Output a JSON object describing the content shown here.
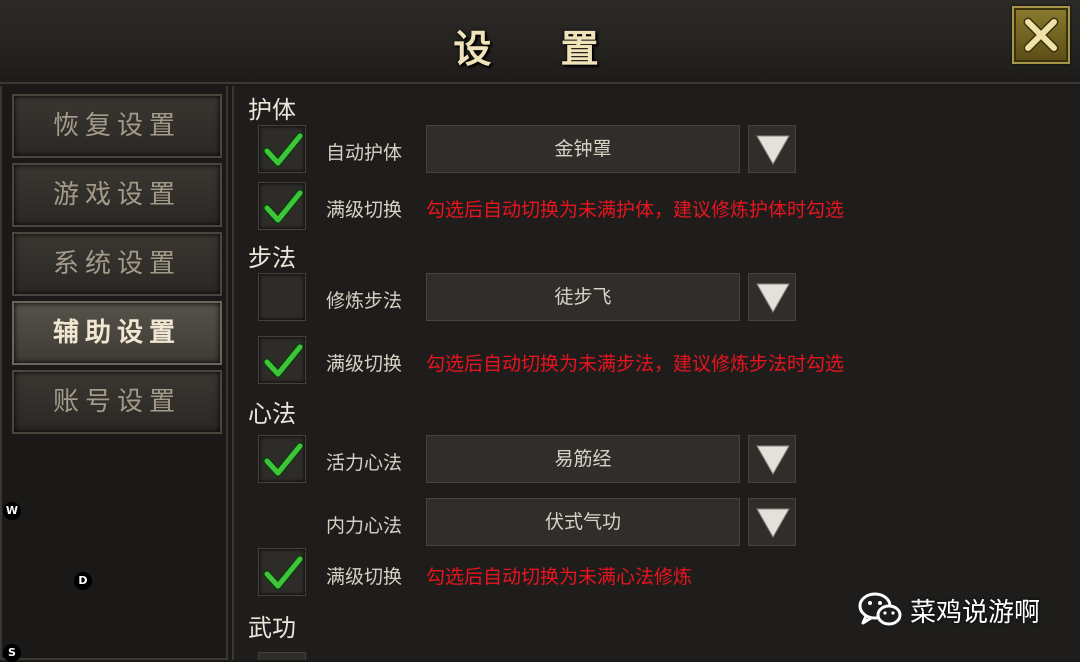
{
  "window": {
    "title": "设 置",
    "close_icon": "close-x-icon"
  },
  "sidebar": {
    "items": [
      {
        "label": "恢复设置",
        "active": false
      },
      {
        "label": "游戏设置",
        "active": false
      },
      {
        "label": "系统设置",
        "active": false
      },
      {
        "label": "辅助设置",
        "active": true
      },
      {
        "label": "账号设置",
        "active": false
      }
    ],
    "markers": [
      "W",
      "D",
      "S"
    ]
  },
  "main": {
    "sections": {
      "hu_ti": "护体",
      "bu_fa": "步法",
      "xin_fa": "心法",
      "wu_gong": "武功"
    },
    "rows": {
      "auto_hu_ti": {
        "label": "自动护体",
        "checked": true,
        "value": "金钟罩"
      },
      "hu_ti_switch": {
        "label": "满级切换",
        "checked": true,
        "hint": "勾选后自动切换为未满护体，建议修炼护体时勾选"
      },
      "train_bu_fa": {
        "label": "修炼步法",
        "checked": false,
        "value": "徒步飞"
      },
      "bu_fa_switch": {
        "label": "满级切换",
        "checked": true,
        "hint": "勾选后自动切换为未满步法，建议修炼步法时勾选"
      },
      "vitality_xin_fa": {
        "label": "活力心法",
        "checked": true,
        "value": "易筋经"
      },
      "inner_xin_fa": {
        "label": "内力心法",
        "value": "伏式气功"
      },
      "xin_fa_switch": {
        "label": "满级切换",
        "checked": true,
        "hint": "勾选后自动切换为未满心法修炼"
      }
    }
  },
  "watermark": {
    "text": "菜鸡说游啊",
    "icon": "wechat-icon"
  },
  "colors": {
    "accent_gold": "#f1e3b9",
    "hint_red": "#e8141e",
    "check_green": "#3ec43a"
  }
}
